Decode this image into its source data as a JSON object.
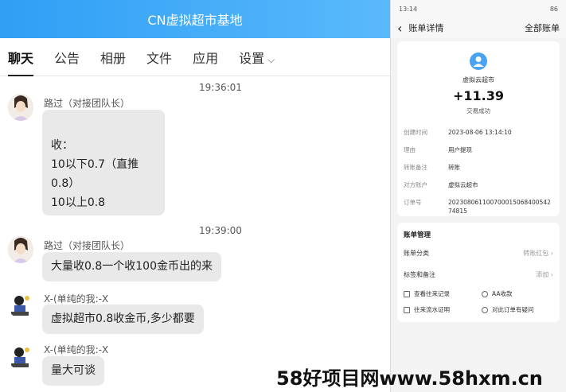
{
  "chat": {
    "title": "CN虚拟超市基地",
    "tabs": [
      "聊天",
      "公告",
      "相册",
      "文件",
      "应用",
      "设置"
    ],
    "messages": [
      {
        "time": "19:36:01",
        "sender": "路过（对接团队长）",
        "lines": [
          "收：",
          "10以下0.7（直推0.8）",
          "10以上0.8"
        ]
      },
      {
        "time": "19:39:00",
        "sender": "路过（对接团队长）",
        "lines": [
          "大量收0.8一个收100金币出的来"
        ]
      },
      {
        "sender": "X-(单纯的我:-X",
        "lines": [
          "虚拟超市0.8收金币,多少都要"
        ]
      },
      {
        "sender": "X-(单纯的我:-X",
        "lines": [
          "量大可谈"
        ]
      }
    ]
  },
  "phone": {
    "status_time": "13:14",
    "status_right": "86",
    "nav": {
      "back": "‹",
      "title": "账单详情",
      "right": "全部账单"
    },
    "merchant": "虚拟云超市",
    "amount": "+11.39",
    "status": "交易成功",
    "details": [
      {
        "k": "创建时间",
        "v": "2023-08-06 13:14:10"
      },
      {
        "k": "理由",
        "v": "用户提现"
      },
      {
        "k": "转账备注",
        "v": "转账"
      },
      {
        "k": "对方账户",
        "v": "虚拟云超市"
      },
      {
        "k": "订单号",
        "v": "20230806110070001506840054274815"
      }
    ],
    "manage_title": "账单管理",
    "manage": [
      {
        "k": "账单分类",
        "v": "转账红包 ›"
      },
      {
        "k": "标签和备注",
        "v": "添加 ›"
      }
    ],
    "actions": [
      "查看往来记录",
      "AA收款",
      "往来流水证明",
      "对此订单有疑问"
    ]
  },
  "watermark": "58好项目网www.58hxm.cn",
  "colors": {
    "header_blue": "#2f9ff5",
    "avatar_blue": "#4aa3f0"
  }
}
